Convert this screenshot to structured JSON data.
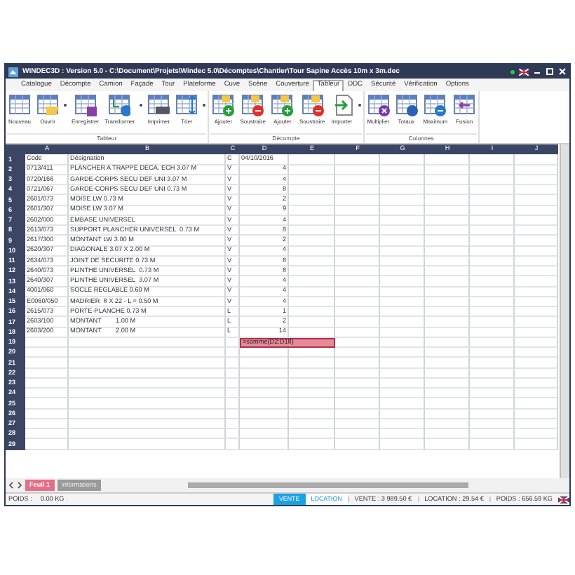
{
  "window": {
    "title": "WINDEC3D : Version 5.0 - C:\\Document\\Projets\\Windec 5.0\\Décomptes\\Chantier\\Tour Sapine Accès 10m x 3m.dec"
  },
  "menu": [
    {
      "label": "Catalogue",
      "selected": false
    },
    {
      "label": "Décompte",
      "selected": false
    },
    {
      "label": "Camion",
      "selected": false
    },
    {
      "label": "Façade",
      "selected": false
    },
    {
      "label": "Tour",
      "selected": false
    },
    {
      "label": "Plateforme",
      "selected": false
    },
    {
      "label": "Cuve",
      "selected": false
    },
    {
      "label": "Scène",
      "selected": false
    },
    {
      "label": "Couverture",
      "selected": false
    },
    {
      "label": "Tableur",
      "selected": true
    },
    {
      "label": "DDC",
      "selected": false
    },
    {
      "label": "Sécurité",
      "selected": false
    },
    {
      "label": "Vérification",
      "selected": false
    },
    {
      "label": "Options",
      "selected": false
    }
  ],
  "ribbon": [
    {
      "label": "Tableur",
      "buttons": [
        {
          "label": "Nouveau",
          "kind": "new",
          "has_menu": false
        },
        {
          "label": "Ouvrir",
          "kind": "open",
          "has_menu": true
        },
        {
          "label": "Enregistrer",
          "kind": "save",
          "has_menu": false
        },
        {
          "label": "Transformer",
          "kind": "convert",
          "has_menu": true
        },
        {
          "label": "Imprimer",
          "kind": "print",
          "has_menu": false
        },
        {
          "label": "Trier",
          "kind": "sort",
          "has_menu": true
        }
      ]
    },
    {
      "label": "Décompte",
      "buttons": [
        {
          "label": "Ajouter",
          "kind": "add",
          "has_menu": false
        },
        {
          "label": "Soustraire",
          "kind": "subtract",
          "has_menu": false
        },
        {
          "label": "Ajouter",
          "kind": "add",
          "has_menu": false
        },
        {
          "label": "Soustraire",
          "kind": "subtract",
          "has_menu": false
        },
        {
          "label": "Importer",
          "kind": "import",
          "has_menu": true
        }
      ]
    },
    {
      "label": "Colonnes",
      "buttons": [
        {
          "label": "Multiplier",
          "kind": "multiply",
          "has_menu": false
        },
        {
          "label": "Totaux",
          "kind": "total",
          "has_menu": false
        },
        {
          "label": "Maximum",
          "kind": "maximum",
          "has_menu": false
        },
        {
          "label": "Fusion",
          "kind": "merge",
          "has_menu": false
        }
      ]
    }
  ],
  "sheet": {
    "columns": [
      "A",
      "B",
      "C",
      "D",
      "E",
      "F",
      "G",
      "H",
      "I",
      "J"
    ],
    "rows": [
      {
        "number": "1",
        "cells": {
          "A": "Code",
          "B": "Désignation",
          "C": "C",
          "D": "04/10/2016"
        }
      },
      {
        "number": "2",
        "cells": {
          "A": "0713/411",
          "B": "PLANCHER A TRAPPE DECA. ECH 3.07 M",
          "C": "V",
          "D": "4"
        }
      },
      {
        "number": "3",
        "cells": {
          "A": "0720/166",
          "B": "GARDE-CORPS SECU DEF UNI 3.07 M",
          "C": "V",
          "D": "4"
        }
      },
      {
        "number": "4",
        "cells": {
          "A": "0721/067",
          "B": "GARDE-CORPS SECU DEF UNI 0.73 M",
          "C": "V",
          "D": "8"
        }
      },
      {
        "number": "5",
        "cells": {
          "A": "2601/073",
          "B": "MOISE LW 0.73 M",
          "C": "V",
          "D": "2"
        }
      },
      {
        "number": "6",
        "cells": {
          "A": "2601/307",
          "B": "MOISE LW 3.07 M",
          "C": "V",
          "D": "9"
        }
      },
      {
        "number": "7",
        "cells": {
          "A": "2602/000",
          "B": "EMBASE UNIVERSEL",
          "C": "V",
          "D": "4"
        }
      },
      {
        "number": "8",
        "cells": {
          "A": "2613/073",
          "B": "SUPPORT PLANCHER UNIVERSEL  0.73 M",
          "C": "V",
          "D": "8"
        }
      },
      {
        "number": "9",
        "cells": {
          "A": "2617/300",
          "B": "MONTANT LW 3.00 M",
          "C": "V",
          "D": "2"
        }
      },
      {
        "number": "10",
        "cells": {
          "A": "2620/307",
          "B": "DIAGONALE 3.07 X 2.00 M",
          "C": "V",
          "D": "4"
        }
      },
      {
        "number": "11",
        "cells": {
          "A": "2634/073",
          "B": "JOINT DE SECURITE 0.73 M",
          "C": "V",
          "D": "8"
        }
      },
      {
        "number": "12",
        "cells": {
          "A": "2640/073",
          "B": "PLINTHE UNIVERSEL  0.73 M",
          "C": "V",
          "D": "8"
        }
      },
      {
        "number": "13",
        "cells": {
          "A": "2640/307",
          "B": "PLINTHE UNIVERSEL  3.07 M",
          "C": "V",
          "D": "4"
        }
      },
      {
        "number": "14",
        "cells": {
          "A": "4001/060",
          "B": "SOCLE REGLABLE 0.60 M",
          "C": "V",
          "D": "4"
        }
      },
      {
        "number": "15",
        "cells": {
          "A": "E0060/050",
          "B": "MADRIER  8 X 22 - L = 0.50 M",
          "C": "V",
          "D": "4"
        }
      },
      {
        "number": "16",
        "cells": {
          "A": "2615/073",
          "B": "PORTE-PLANCHE 0.73 M",
          "C": "L",
          "D": "1"
        }
      },
      {
        "number": "17",
        "cells": {
          "A": "2603/100",
          "B": "MONTANT        1.00 M",
          "C": "L",
          "D": "2"
        }
      },
      {
        "number": "18",
        "cells": {
          "A": "2603/200",
          "B": "MONTANT        2.00 M",
          "C": "L",
          "D": "14"
        }
      },
      {
        "number": "19",
        "editing": true,
        "cells": {
          "D": "=somme(D2:D18)"
        }
      },
      {
        "number": "20"
      },
      {
        "number": "21"
      },
      {
        "number": "22"
      },
      {
        "number": "23"
      },
      {
        "number": "24"
      },
      {
        "number": "25"
      },
      {
        "number": "26"
      },
      {
        "number": "27"
      },
      {
        "number": "28"
      },
      {
        "number": "29"
      }
    ]
  },
  "sheet_tabs": [
    {
      "label": "Feuil 1",
      "selected": true
    },
    {
      "label": "Informations",
      "selected": false
    }
  ],
  "status_bar": {
    "weight_label": "POIDS :",
    "weight_value": "0.00 KG",
    "modes": [
      {
        "label": "VENTE",
        "selected": true
      },
      {
        "label": "LOCATION",
        "selected": false
      }
    ],
    "totals": [
      "VENTE : 3 989.50 €",
      "LOCATION : 29.54 €",
      "POIDS : 656.59 KG"
    ]
  }
}
